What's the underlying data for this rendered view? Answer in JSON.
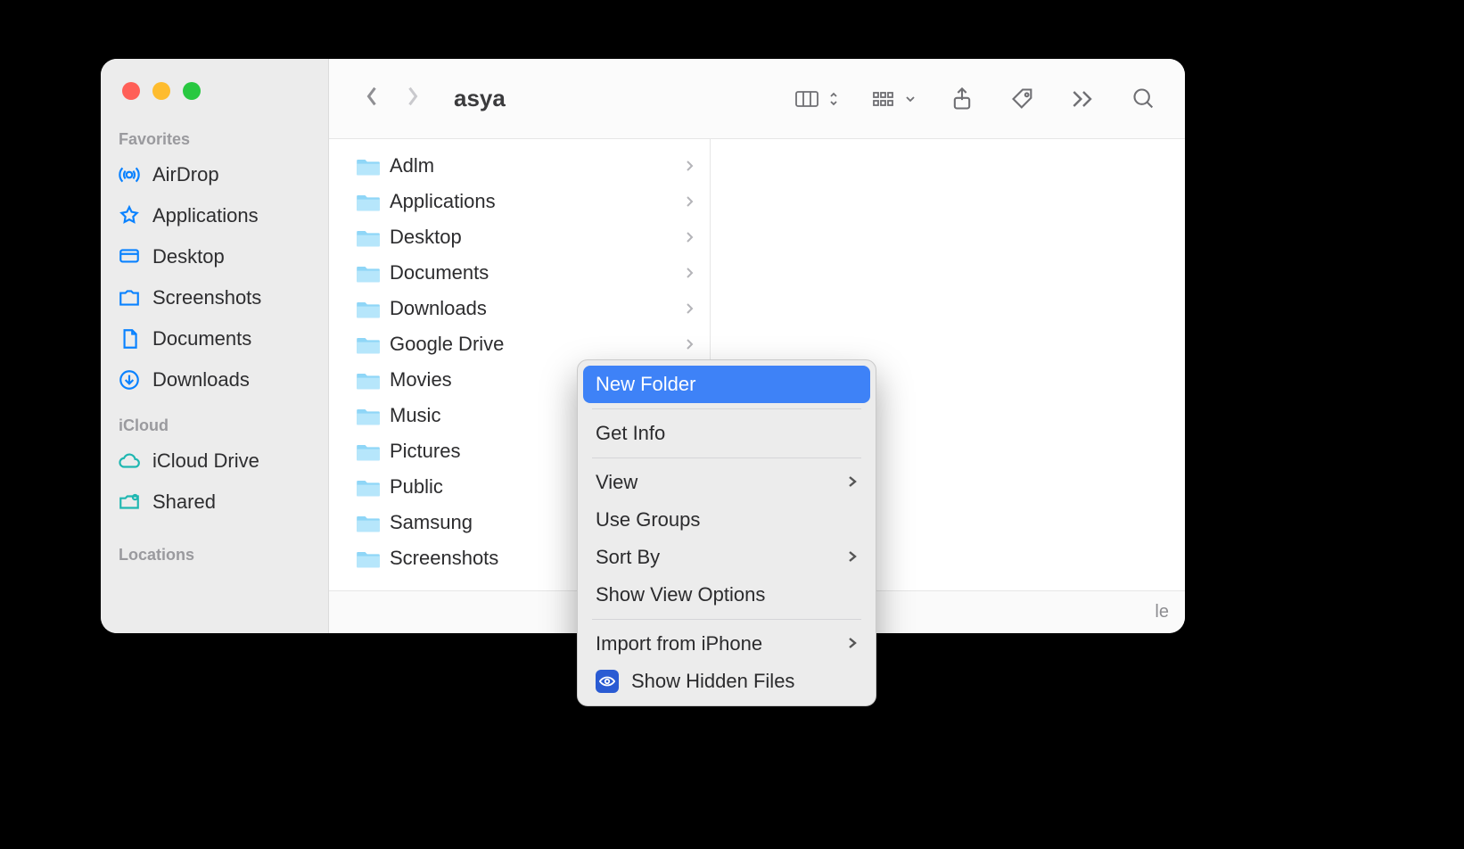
{
  "window_title": "asya",
  "sidebar": {
    "sections": [
      {
        "label": "Favorites",
        "items": [
          {
            "icon": "airdrop-icon",
            "label": "AirDrop"
          },
          {
            "icon": "applications-icon",
            "label": "Applications"
          },
          {
            "icon": "desktop-icon",
            "label": "Desktop"
          },
          {
            "icon": "screenshots-folder-icon",
            "label": "Screenshots"
          },
          {
            "icon": "documents-icon",
            "label": "Documents"
          },
          {
            "icon": "downloads-icon",
            "label": "Downloads"
          }
        ]
      },
      {
        "label": "iCloud",
        "items": [
          {
            "icon": "icloud-drive-icon",
            "label": "iCloud Drive"
          },
          {
            "icon": "shared-icon",
            "label": "Shared"
          }
        ]
      },
      {
        "label": "Locations",
        "items": []
      }
    ]
  },
  "folder_items": [
    {
      "name": "Adlm",
      "type": "folder"
    },
    {
      "name": "Applications",
      "type": "folder"
    },
    {
      "name": "Desktop",
      "type": "folder"
    },
    {
      "name": "Documents",
      "type": "folder"
    },
    {
      "name": "Downloads",
      "type": "folder"
    },
    {
      "name": "Google Drive",
      "type": "folder"
    },
    {
      "name": "Movies",
      "type": "folder"
    },
    {
      "name": "Music",
      "type": "folder"
    },
    {
      "name": "Pictures",
      "type": "folder"
    },
    {
      "name": "Public",
      "type": "folder"
    },
    {
      "name": "Samsung",
      "type": "folder"
    },
    {
      "name": "Screenshots",
      "type": "folder"
    }
  ],
  "status_partial_text": "le",
  "context_menu": {
    "items": [
      {
        "label": "New Folder",
        "highlighted": true
      },
      {
        "separator": true
      },
      {
        "label": "Get Info"
      },
      {
        "separator": true
      },
      {
        "label": "View",
        "submenu": true
      },
      {
        "label": "Use Groups"
      },
      {
        "label": "Sort By",
        "submenu": true
      },
      {
        "label": "Show View Options"
      },
      {
        "separator": true
      },
      {
        "label": "Import from iPhone",
        "submenu": true
      },
      {
        "label": "Show Hidden Files",
        "prefix_icon": "eye-icon"
      }
    ]
  }
}
